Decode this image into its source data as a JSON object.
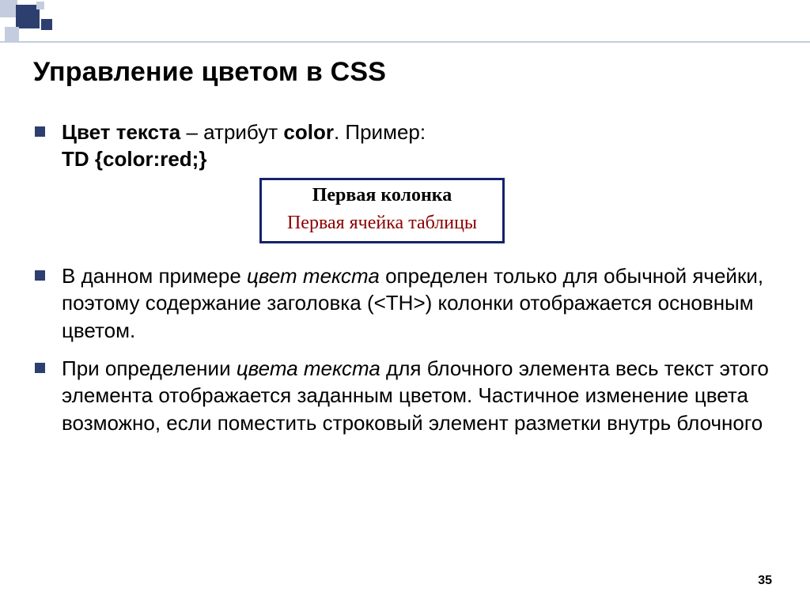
{
  "title": "Управление цветом в CSS",
  "bullet1": {
    "strong": "Цвет текста",
    "dash": " – атрибут ",
    "attr": "color",
    "afterAttr": ". Пример:",
    "code": "TD {color:red;}"
  },
  "example": {
    "header": "Первая колонка",
    "cell": "Первая ячейка таблицы"
  },
  "bullet2": {
    "p1": "В данном примере ",
    "em1": "цвет текста",
    "p2": " определен только для обычной ячейки, поэтому содержание заголовка (<TH>) колонки отображается основным цветом."
  },
  "bullet3": {
    "p1": "При определении ",
    "em1": "цвета текста",
    "p2": " для блочного элемента весь текст этого элемента отображается заданным цветом. Частичное изменение цвета возможно, если поместить строковый элемент разметки внутрь блочного"
  },
  "pageNumber": "35"
}
